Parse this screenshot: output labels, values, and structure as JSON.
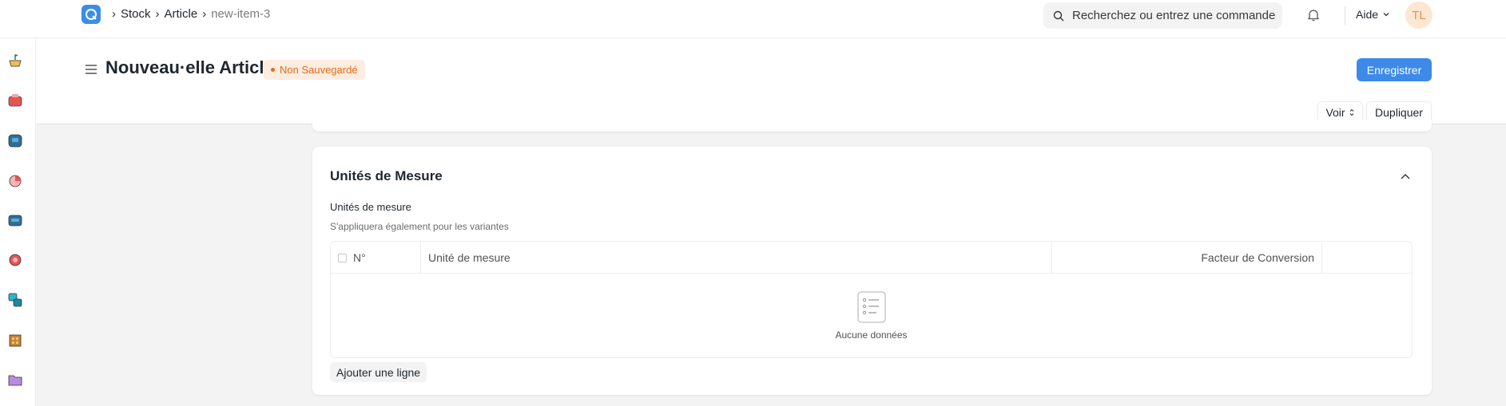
{
  "breadcrumb": {
    "items": [
      "Stock",
      "Article",
      "new-item-3"
    ]
  },
  "search": {
    "placeholder": "Recherchez ou entrez une commande"
  },
  "navbar": {
    "help_label": "Aide",
    "avatar_initials": "TL"
  },
  "page": {
    "title": "Nouveau·elle Article",
    "status_badge": "Non Sauvegardé",
    "primary_button": "Enregistrer",
    "view_button": "Voir",
    "duplicate_button": "Dupliquer"
  },
  "section": {
    "title": "Unités de Mesure",
    "field_label": "Unités de mesure",
    "field_description": "S'appliquera également pour les variantes",
    "columns": [
      "N°",
      "Unité de mesure",
      "Facteur de Conversion"
    ],
    "empty_text": "Aucune données",
    "add_row_button": "Ajouter une ligne"
  },
  "sidebar_icons": [
    "stock-icon",
    "sales-icon",
    "buying-icon",
    "accounting-icon",
    "crm-icon",
    "support-icon",
    "projects-icon",
    "assets-icon",
    "folder-icon"
  ],
  "colors": {
    "accent": "#3d8ae8",
    "warning": "#e86c13"
  }
}
